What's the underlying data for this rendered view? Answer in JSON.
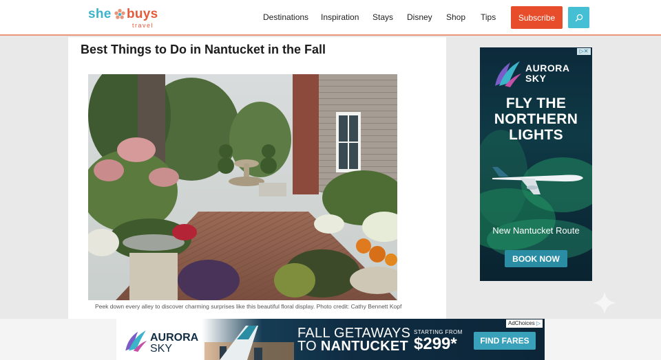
{
  "header": {
    "logo": {
      "part1": "she",
      "part2": "buys",
      "tagline": "travel"
    },
    "nav": [
      "Destinations",
      "Inspiration",
      "Stays",
      "Disney",
      "Shop",
      "Tips"
    ],
    "subscribe_label": "Subscribe",
    "search_icon": "search-icon"
  },
  "article": {
    "title": "Best Things to Do in Nantucket in the Fall",
    "photo_caption": "Peek down every alley to discover charming surprises like this beautiful floral display. Photo credit: Cathy Bennett Kopf"
  },
  "side_ad": {
    "brand_line1": "AURORA",
    "brand_line2": "SKY",
    "headline": [
      "FLY THE",
      "NORTHERN",
      "LIGHTS"
    ],
    "subtitle": "New Nantucket Route",
    "cta": "BOOK NOW"
  },
  "bottom_ad": {
    "adchoices": "AdChoices",
    "brand_line1": "AURORA",
    "brand_line2": "SKY",
    "headline_line1": "FALL GETAWAYS",
    "headline_to": "TO",
    "headline_place": "NANTUCKET",
    "price_label": "STARTING FROM",
    "price": "$299*",
    "cta": "FIND FARES"
  },
  "colors": {
    "brand_teal": "#3bb3c9",
    "brand_red": "#e35a3a",
    "subscribe_bg": "#e84d2b",
    "search_bg": "#44bfd4",
    "ad_navy": "#0f2c42"
  }
}
